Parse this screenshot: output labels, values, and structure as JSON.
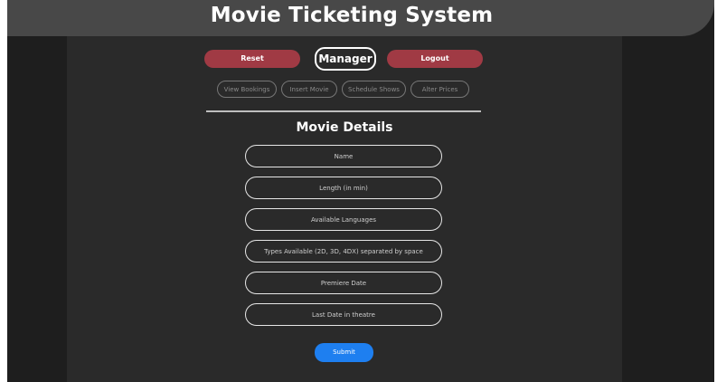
{
  "app": {
    "title": "Movie Ticketing System"
  },
  "header": {
    "reset_label": "Reset",
    "role_label": "Manager",
    "logout_label": "Logout"
  },
  "tabs": [
    {
      "label": "View Bookings"
    },
    {
      "label": "Insert Movie"
    },
    {
      "label": "Schedule Shows"
    },
    {
      "label": "Alter Prices"
    }
  ],
  "form": {
    "title": "Movie Details",
    "fields": [
      {
        "placeholder": "Name",
        "value": ""
      },
      {
        "placeholder": "Length (in min)",
        "value": ""
      },
      {
        "placeholder": "Available Languages",
        "value": ""
      },
      {
        "placeholder": "Types Available (2D, 3D, 4DX) separated by space",
        "value": ""
      },
      {
        "placeholder": "Premiere Date",
        "value": ""
      },
      {
        "placeholder": "Last Date in theatre",
        "value": ""
      }
    ],
    "submit_label": "Submit"
  },
  "colors": {
    "background": "#1e1e1e",
    "titlebar": "#484848",
    "panel": "#2a2a2a",
    "danger_button": "#a03a44",
    "primary_button": "#1e7ff0"
  }
}
